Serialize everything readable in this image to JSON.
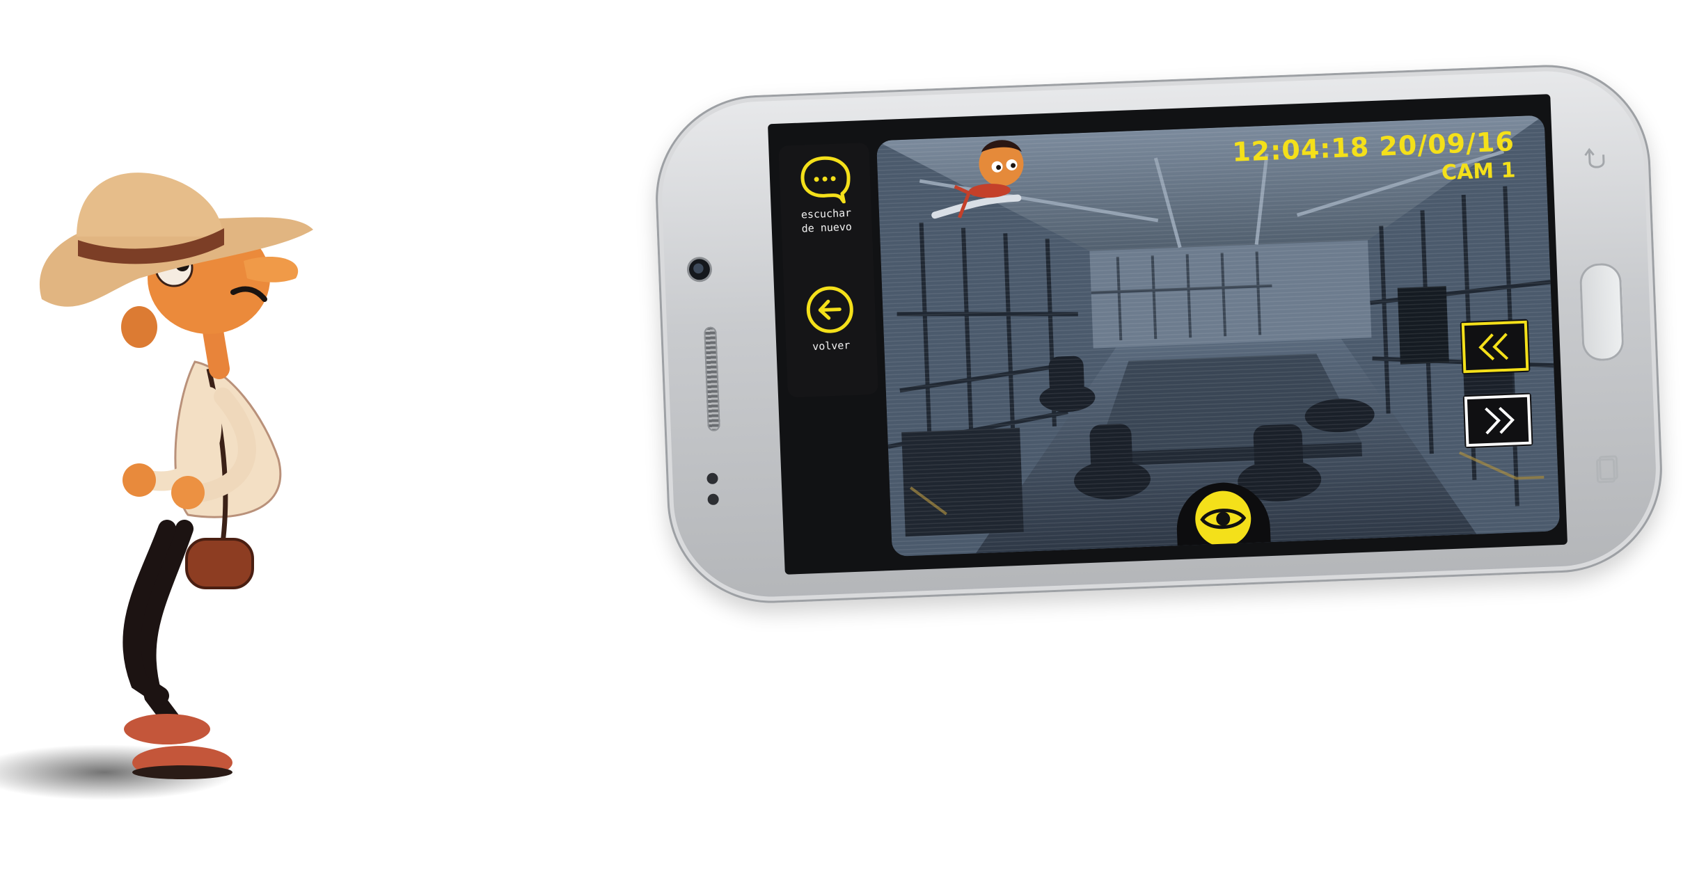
{
  "screen": {
    "timestamp": "12:04:18 20/09/16",
    "camera_label": "CAM 1"
  },
  "side_panel": {
    "listen_again_label_line1": "escuchar",
    "listen_again_label_line2": "de nuevo",
    "back_label": "volver"
  },
  "icons": {
    "listen_again": "speech-bubble-icon",
    "back": "arrow-left-circle-icon",
    "rewind": "double-chevron-left-icon",
    "forward": "double-chevron-right-icon",
    "look": "eye-icon"
  },
  "colors": {
    "accent": "#f4e01a",
    "panel": "#151517",
    "camera_tint": "#4b5a6c"
  }
}
